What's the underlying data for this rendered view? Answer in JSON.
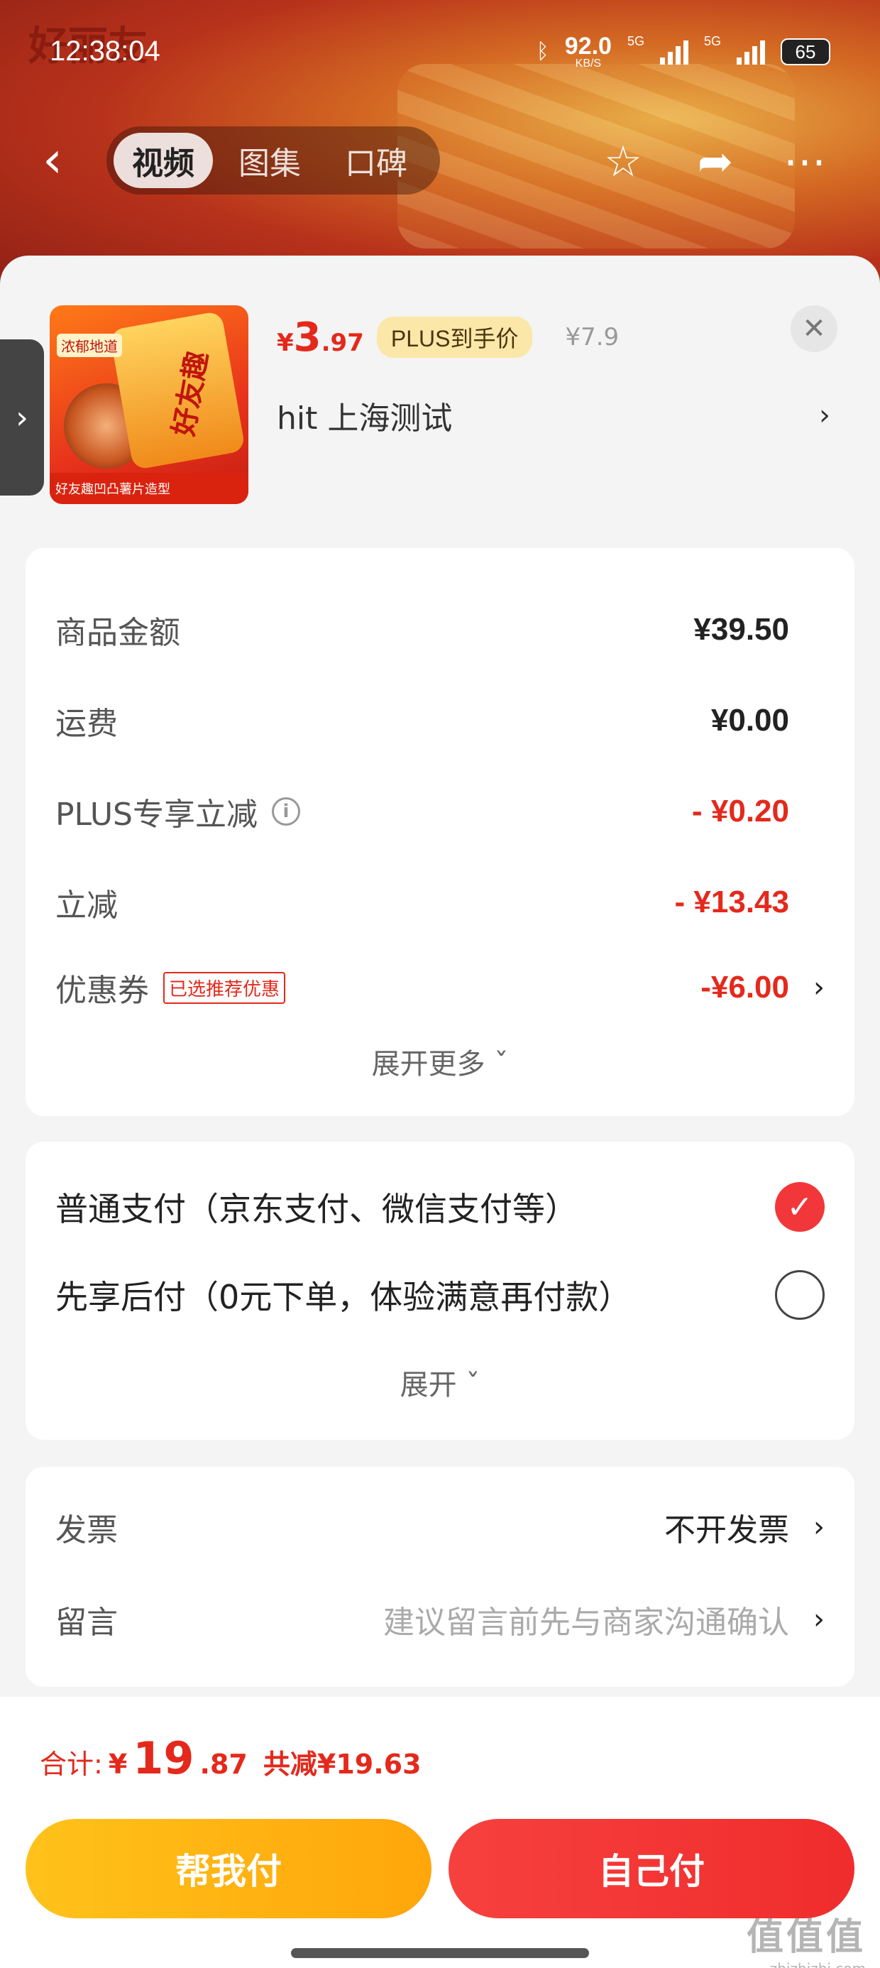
{
  "status_bar": {
    "time": "12:38:04",
    "net_speed": "92.0",
    "net_unit": "KB/S",
    "sig1": "5G",
    "sig2": "5G",
    "battery": "65"
  },
  "background": {
    "logo": "好丽友"
  },
  "nav": {
    "tabs": [
      {
        "label": "视频",
        "active": true
      },
      {
        "label": "图集",
        "active": false
      },
      {
        "label": "口碑",
        "active": false
      }
    ],
    "icons": [
      "back-arrow-icon",
      "star-icon",
      "share-icon",
      "more-icon"
    ]
  },
  "product": {
    "price_symbol": "¥",
    "price_int": "3",
    "price_dec": ".97",
    "plus_tag": "PLUS到手价",
    "original_price": "¥7.9",
    "shop": "hit  上海测试",
    "image_text": "好友趣",
    "image_strip": "好友趣凹凸薯片造型",
    "image_badge": "浓郁地道"
  },
  "summary": {
    "rows": [
      {
        "label": "商品金额",
        "value": "¥39.50"
      },
      {
        "label": "运费",
        "value": "¥0.00"
      },
      {
        "label": "PLUS专享立减",
        "value": "- ¥0.20"
      },
      {
        "label": "立减",
        "value": "- ¥13.43"
      },
      {
        "label": "优惠券",
        "tag": "已选推荐优惠",
        "value": "-¥6.00"
      }
    ],
    "expand": "展开更多 ˇ"
  },
  "payment": {
    "options": [
      {
        "label": "普通支付（京东支付、微信支付等）",
        "checked": true
      },
      {
        "label": "先享后付（0元下单，体验满意再付款）",
        "checked": false
      }
    ],
    "expand": "展开 ˇ"
  },
  "extra": {
    "invoice_label": "发票",
    "invoice_value": "不开发票",
    "note_label": "留言",
    "note_placeholder": "建议留言前先与商家沟通确认"
  },
  "footer": {
    "total_label": "合计:",
    "total_symbol": "¥",
    "total_int": "19",
    "total_dec": ".87",
    "saved": "共减¥19.63",
    "help_pay": "帮我付",
    "self_pay": "自己付",
    "watermark": "值值值",
    "watermark_url": "zhizhizhi.com"
  },
  "colors": {
    "accent_red": "#e4291c",
    "plus_gold": "#fbe7a8",
    "help_btn": "#ffb412",
    "self_btn": "#f23a36"
  }
}
